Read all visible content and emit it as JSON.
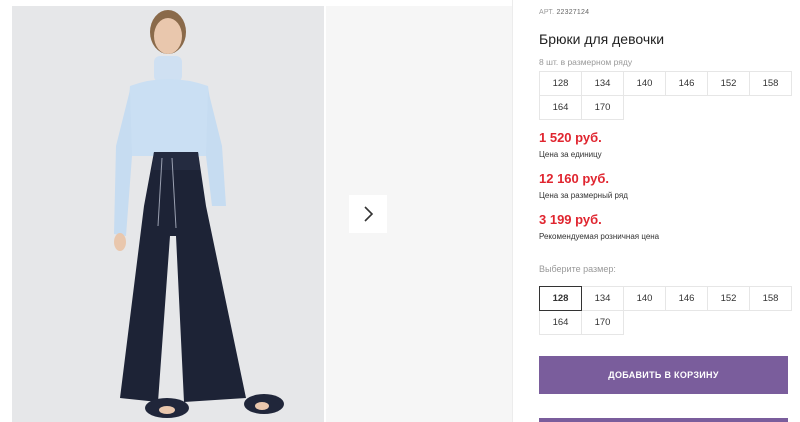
{
  "product": {
    "article_prefix": "АРТ.",
    "article_code": "22327124",
    "title": "Брюки для девочки",
    "size_row_caption": "8 шт. в размерном ряду",
    "size_row": [
      "128",
      "134",
      "140",
      "146",
      "152",
      "158",
      "164",
      "170"
    ]
  },
  "prices": [
    {
      "value": "1 520 руб.",
      "label": "Цена за единицу"
    },
    {
      "value": "12 160 руб.",
      "label": "Цена за размерный ряд"
    },
    {
      "value": "3 199 руб.",
      "label": "Рекомендуемая розничная цена"
    }
  ],
  "size_select": {
    "caption": "Выберите размер:",
    "options": [
      "128",
      "134",
      "140",
      "146",
      "152",
      "158",
      "164",
      "170"
    ],
    "selected": "128"
  },
  "actions": {
    "add_to_cart": "ДОБАВИТЬ В КОРЗИНУ"
  },
  "colors": {
    "price": "#e0252f",
    "button": "#7a5d9c"
  }
}
